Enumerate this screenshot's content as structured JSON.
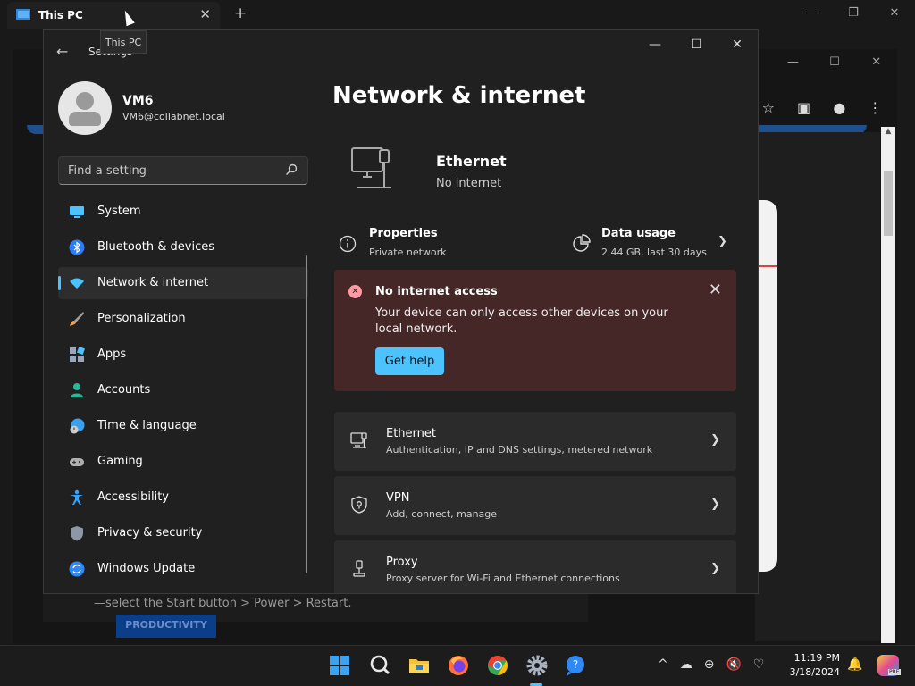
{
  "explorer": {
    "tab_title": "This PC",
    "tooltip": "This PC",
    "tab_close": "✕",
    "new_tab": "+",
    "controls": {
      "minimize": "—",
      "maximize": "❐",
      "close": "✕"
    }
  },
  "background": {
    "article_text": "—select the Start button > Power > Restart.",
    "pill_text": "PRODUCTIVITY",
    "chrome_controls": {
      "minimize": "—",
      "maximize": "☐",
      "close": "✕"
    },
    "chrome_toolbar": [
      "☆",
      "▣",
      "●",
      "⋮"
    ]
  },
  "settings": {
    "window_title": "Settings",
    "back": "←",
    "controls": {
      "minimize": "—",
      "maximize": "☐",
      "close": "✕"
    },
    "user": {
      "name": "VM6",
      "email": "VM6@collabnet.local"
    },
    "search": {
      "placeholder": "Find a setting"
    },
    "nav": [
      {
        "label": "System",
        "icon": "monitor-icon",
        "color": "#4cc2ff"
      },
      {
        "label": "Bluetooth & devices",
        "icon": "bluetooth-icon",
        "color": "#2d7cf6"
      },
      {
        "label": "Network & internet",
        "icon": "wifi-icon",
        "color": "#4cc2ff",
        "selected": true
      },
      {
        "label": "Personalization",
        "icon": "brush-icon",
        "color": "#e8a25c"
      },
      {
        "label": "Apps",
        "icon": "apps-icon",
        "color": "#9aa7b8"
      },
      {
        "label": "Accounts",
        "icon": "person-icon",
        "color": "#25b99a"
      },
      {
        "label": "Time & language",
        "icon": "globe-clock-icon",
        "color": "#3aa0f0"
      },
      {
        "label": "Gaming",
        "icon": "gamepad-icon",
        "color": "#b0b0b0"
      },
      {
        "label": "Accessibility",
        "icon": "accessibility-icon",
        "color": "#34a6ff"
      },
      {
        "label": "Privacy & security",
        "icon": "shield-icon",
        "color": "#8d97a5"
      },
      {
        "label": "Windows Update",
        "icon": "update-icon",
        "color": "#2f89f5"
      }
    ],
    "page_title": "Network & internet",
    "ethernet": {
      "name": "Ethernet",
      "status": "No internet"
    },
    "properties": {
      "title": "Properties",
      "subtitle": "Private network"
    },
    "data_usage": {
      "title": "Data usage",
      "subtitle": "2.44 GB, last 30 days"
    },
    "alert": {
      "title": "No internet access",
      "body": "Your device can only access other devices on your local network.",
      "button": "Get help"
    },
    "rows": [
      {
        "title": "Ethernet",
        "subtitle": "Authentication, IP and DNS settings, metered network",
        "icon": "ethernet-icon"
      },
      {
        "title": "VPN",
        "subtitle": "Add, connect, manage",
        "icon": "vpn-shield-icon"
      },
      {
        "title": "Proxy",
        "subtitle": "Proxy server for Wi-Fi and Ethernet connections",
        "icon": "proxy-icon"
      }
    ]
  },
  "taskbar": {
    "time": "11:19 PM",
    "date": "3/18/2024",
    "tray": [
      "^",
      "☁",
      "⊕",
      "🔇",
      "♡"
    ],
    "bell": "🔔",
    "copilot_badge": "PRE"
  }
}
